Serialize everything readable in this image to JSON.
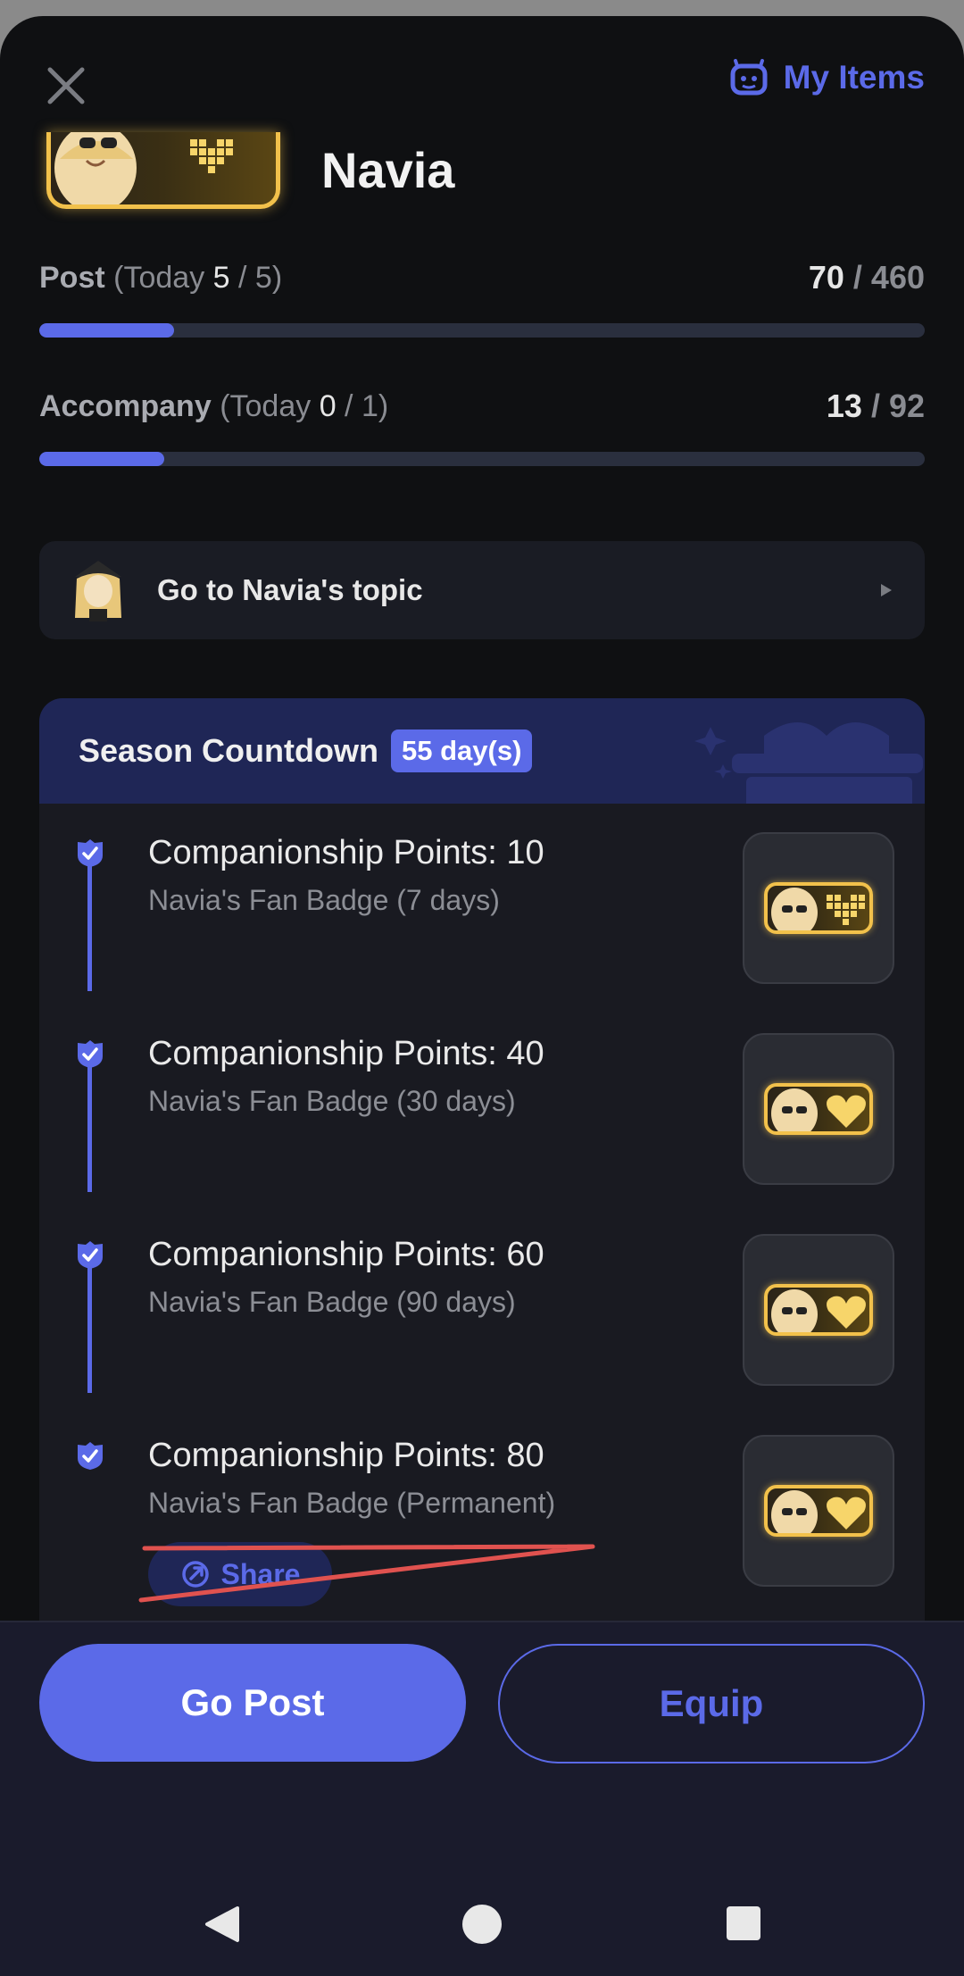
{
  "topbar": {
    "my_items_label": "My Items"
  },
  "header": {
    "name": "Navia"
  },
  "post": {
    "label": "Post",
    "today_prefix": "(Today ",
    "today_value": "5",
    "today_sep": " / ",
    "today_max": "5",
    "today_suffix": ")",
    "current": "70",
    "sep": " / ",
    "total": "460",
    "fraction": 0.152
  },
  "accompany": {
    "label": "Accompany",
    "today_prefix": "(Today ",
    "today_value": "0",
    "today_sep": " / ",
    "today_max": "1",
    "today_suffix": ")",
    "current": "13",
    "sep": " / ",
    "total": "92",
    "fraction": 0.141
  },
  "topic": {
    "label": "Go to Navia's topic"
  },
  "season": {
    "title": "Season Countdown",
    "countdown": "55 day(s)",
    "rewards": [
      {
        "title": "Companionship Points: 10",
        "subtitle": "Navia's Fan Badge (7 days)"
      },
      {
        "title": "Companionship Points: 40",
        "subtitle": "Navia's Fan Badge (30 days)"
      },
      {
        "title": "Companionship Points: 60",
        "subtitle": "Navia's Fan Badge (90 days)"
      },
      {
        "title": "Companionship Points: 80",
        "subtitle": "Navia's Fan Badge (Permanent)"
      }
    ],
    "share_label": "Share"
  },
  "actions": {
    "go_post_label": "Go Post",
    "equip_label": "Equip"
  },
  "colors": {
    "accent": "#5b6ae8",
    "gold": "#f2c14b",
    "background": "#0f1012",
    "annotation": "#e0524f"
  },
  "icons": [
    "close-icon",
    "robot-face-icon",
    "heart-pixel-icon",
    "play-arrow-icon",
    "check-shield-icon",
    "share-icon",
    "gift-decoration-icon",
    "nav-back-icon",
    "nav-home-icon",
    "nav-recent-icon"
  ]
}
